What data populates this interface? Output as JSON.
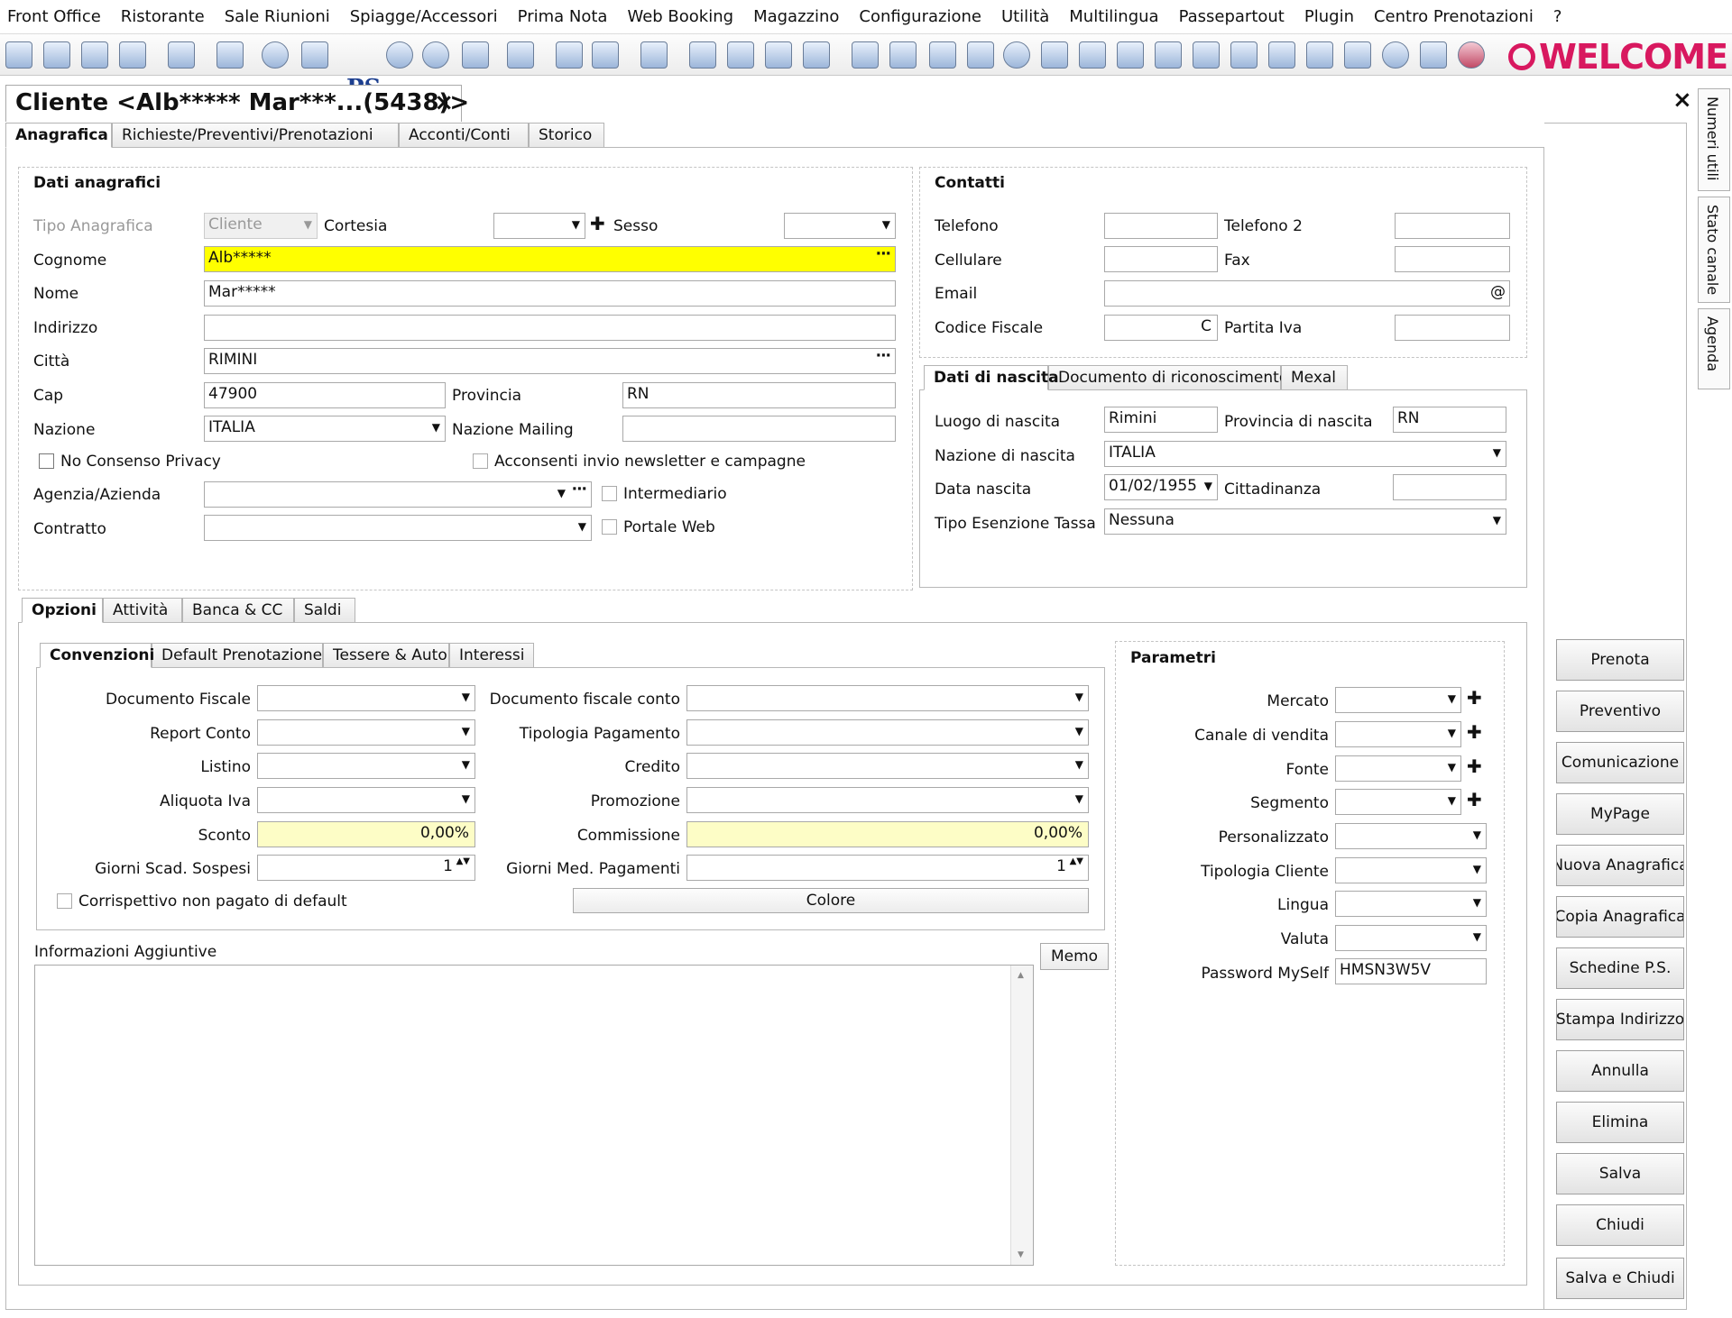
{
  "menu": [
    "Front Office",
    "Ristorante",
    "Sale Riunioni",
    "Spiagge/Accessori",
    "Prima Nota",
    "Web Booking",
    "Magazzino",
    "Configurazione",
    "Utilità",
    "Multilingua",
    "Passepartout",
    "Plugin",
    "Centro Prenotazioni",
    "?"
  ],
  "brand": "WELCOME",
  "toolbar_ps": "PS",
  "document_tab": "Cliente <Alb***** Mar***...(5438)>",
  "close_glyph": "×",
  "main_tabs": [
    "Anagrafica",
    "Richieste/Preventivi/Prenotazioni",
    "Acconti/Conti",
    "Storico"
  ],
  "vertical_tabs": [
    "Numeri utili",
    "Stato canale",
    "Agenda"
  ],
  "anagrafici": {
    "title": "Dati anagrafici",
    "tipo_label": "Tipo Anagrafica",
    "tipo_value": "Cliente",
    "cortesia_label": "Cortesia",
    "sesso_label": "Sesso",
    "cognome_label": "Cognome",
    "cognome_value": "Alb*****",
    "nome_label": "Nome",
    "nome_value": "Mar*****",
    "indirizzo_label": "Indirizzo",
    "citta_label": "Città",
    "citta_value": "RIMINI",
    "cap_label": "Cap",
    "cap_value": "47900",
    "provincia_label": "Provincia",
    "provincia_value": "RN",
    "nazione_label": "Nazione",
    "nazione_value": "ITALIA",
    "nazione_mailing_label": "Nazione Mailing",
    "privacy_label": "No Consenso Privacy",
    "newsletter_label": "Acconsenti invio newsletter e campagne",
    "agenzia_label": "Agenzia/Azienda",
    "intermediario_label": "Intermediario",
    "contratto_label": "Contratto",
    "portale_label": "Portale Web"
  },
  "contatti": {
    "title": "Contatti",
    "telefono_label": "Telefono",
    "telefono2_label": "Telefono 2",
    "cellulare_label": "Cellulare",
    "fax_label": "Fax",
    "email_label": "Email",
    "email_suffix": "@",
    "cf_label": "Codice Fiscale",
    "cf_button": "C",
    "piva_label": "Partita Iva"
  },
  "nascita_tabs": [
    "Dati di nascita",
    "Documento di riconoscimento",
    "Mexal"
  ],
  "nascita": {
    "luogo_label": "Luogo di nascita",
    "luogo_value": "Rimini",
    "provincia_label": "Provincia di nascita",
    "provincia_value": "RN",
    "nazione_label": "Nazione di nascita",
    "nazione_value": "ITALIA",
    "data_label": "Data nascita",
    "data_value": "01/02/1955",
    "cittadinanza_label": "Cittadinanza",
    "esenzione_label": "Tipo Esenzione Tassa",
    "esenzione_value": "Nessuna"
  },
  "opzioni_tabs": [
    "Opzioni",
    "Attività",
    "Banca & CC",
    "Saldi"
  ],
  "conv_tabs": [
    "Convenzioni",
    "Default Prenotazione",
    "Tessere & Auto",
    "Interessi"
  ],
  "convenzioni": {
    "doc_fiscale_label": "Documento Fiscale",
    "doc_fiscale_conto_label": "Documento fiscale conto",
    "report_conto_label": "Report Conto",
    "tipologia_pagamento_label": "Tipologia Pagamento",
    "listino_label": "Listino",
    "credito_label": "Credito",
    "aliquota_label": "Aliquota Iva",
    "promozione_label": "Promozione",
    "sconto_label": "Sconto",
    "sconto_value": "0,00%",
    "commissione_label": "Commissione",
    "commissione_value": "0,00%",
    "giorni_scad_label": "Giorni Scad. Sospesi",
    "giorni_scad_value": "1",
    "giorni_med_label": "Giorni Med. Pagamenti",
    "giorni_med_value": "1",
    "corrispettivo_label": "Corrispettivo non pagato di default",
    "colore_label": "Colore"
  },
  "info": {
    "label": "Informazioni Aggiuntive",
    "memo_label": "Memo"
  },
  "parametri": {
    "title": "Parametri",
    "mercato_label": "Mercato",
    "canale_label": "Canale di vendita",
    "fonte_label": "Fonte",
    "segmento_label": "Segmento",
    "personalizzato_label": "Personalizzato",
    "tipologia_cliente_label": "Tipologia Cliente",
    "lingua_label": "Lingua",
    "valuta_label": "Valuta",
    "password_label": "Password MySelf",
    "password_value": "HMSN3W5V"
  },
  "side_buttons": [
    "Prenota",
    "Preventivo",
    "Comunicazione",
    "MyPage",
    "Nuova Anagrafica",
    "Copia Anagrafica",
    "Schedine P.S.",
    "Stampa Indirizzo",
    "Annulla",
    "Elimina",
    "Salva",
    "Chiudi",
    "Salva e Chiudi"
  ],
  "glyphs": {
    "arrow": "▼",
    "dots": "···",
    "plus": "✚",
    "spin": "▲▼",
    "scroll_up": "▲",
    "scroll_down": "▼"
  }
}
